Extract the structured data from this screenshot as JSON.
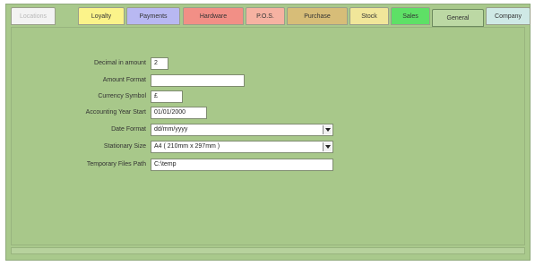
{
  "tabs": [
    {
      "label": "Locations",
      "bg": "#f3f3f3",
      "fg": "#b8b8b8"
    },
    {
      "label": "Loyalty",
      "bg": "#fbf38a",
      "fg": "#333333"
    },
    {
      "label": "Payments",
      "bg": "#b8b8f2",
      "fg": "#333333"
    },
    {
      "label": "Hardware",
      "bg": "#f28f86",
      "fg": "#333333"
    },
    {
      "label": "P.O.S.",
      "bg": "#f6b2a2",
      "fg": "#333333"
    },
    {
      "label": "Purchase",
      "bg": "#d7bd78",
      "fg": "#333333"
    },
    {
      "label": "Stock",
      "bg": "#f1e69a",
      "fg": "#333333"
    },
    {
      "label": "Sales",
      "bg": "#5ee066",
      "fg": "#333333"
    },
    {
      "label": "General",
      "bg": "#bcd8a4",
      "fg": "#333333"
    },
    {
      "label": "Company",
      "bg": "#cfe9e6",
      "fg": "#333333"
    }
  ],
  "selected_tab": "General",
  "form": {
    "decimal_label": "Decimal in amount",
    "decimal_value": "2",
    "amount_format_label": "Amount Format",
    "amount_format_value": "",
    "currency_label": "Currency Symbol",
    "currency_value": "£",
    "year_start_label": "Accounting Year Start",
    "year_start_value": "01/01/2000",
    "date_format_label": "Date Format",
    "date_format_value": "dd/mm/yyyy",
    "stationary_label": "Stationary Size",
    "stationary_value": "A4 ( 210mm x 297mm )",
    "temp_path_label": "Temporary Files Path",
    "temp_path_value": "C:\\temp"
  },
  "colors": {
    "panel": "#a8c88a",
    "selected_tab": "#bcd8a4"
  }
}
